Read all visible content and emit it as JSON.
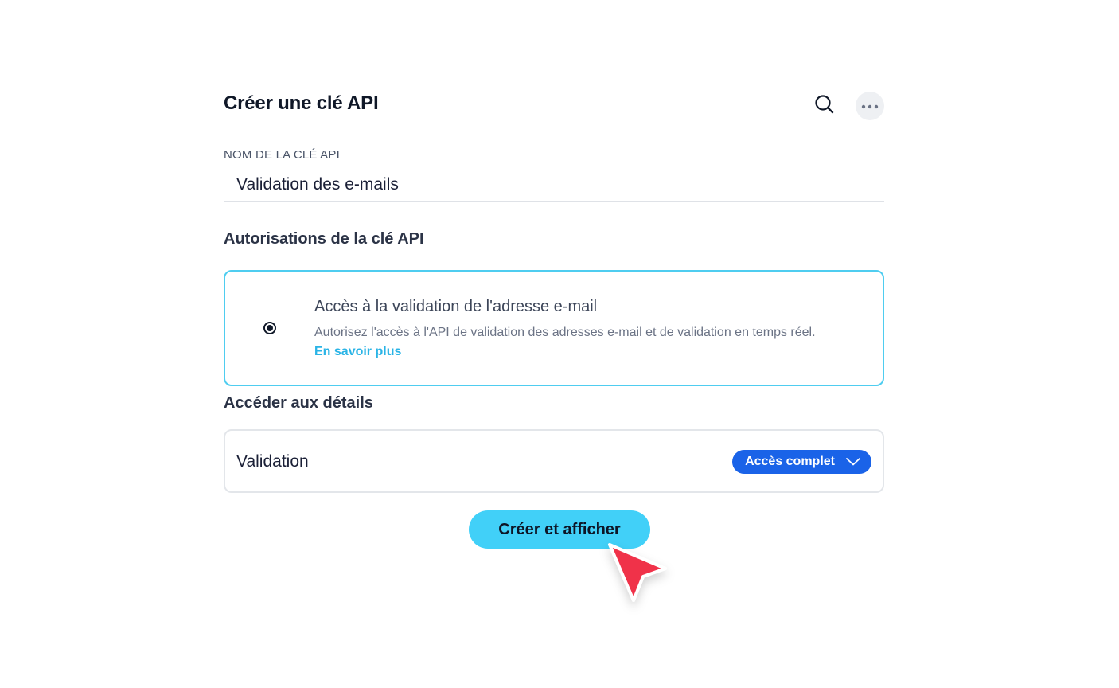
{
  "header": {
    "title": "Créer une clé API",
    "search_icon": "search-icon",
    "more_icon": "more-horizontal-icon"
  },
  "key_name": {
    "label": "NOM DE LA CLÉ API",
    "value": "Validation des e-mails"
  },
  "permissions": {
    "heading": "Autorisations de la clé API",
    "option": {
      "title": "Accès à la validation de l'adresse e-mail",
      "description": "Autorisez l'accès à l'API de validation des adresses e-mail et de validation en temps réel.",
      "link": "En savoir plus",
      "selected": true
    }
  },
  "details": {
    "heading": "Accéder aux détails",
    "row_label": "Validation",
    "access_level": "Accès complet"
  },
  "actions": {
    "create_label": "Créer et afficher"
  },
  "colors": {
    "accent_border": "#4fcdf0",
    "link": "#2ab4e6",
    "select_bg": "#1a63e8",
    "primary_button": "#41d0f8",
    "cursor": "#f0304a"
  }
}
